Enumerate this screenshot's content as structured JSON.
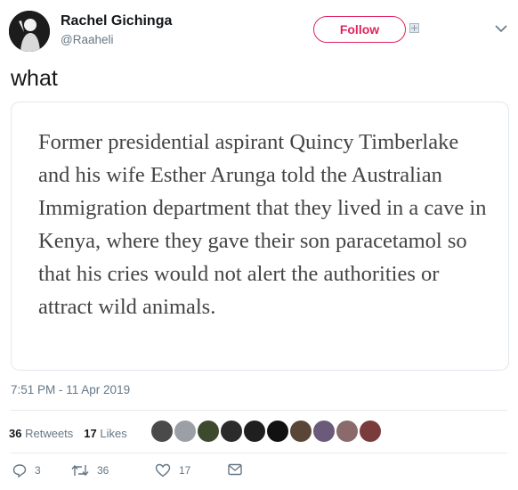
{
  "header": {
    "name": "Rachel Gichinga",
    "handle": "@Raaheli",
    "follow_label": "Follow"
  },
  "tweet": {
    "text": "what",
    "card_text": "Former presidential aspirant Quincy Timberlake and his wife Esther Arunga told the Australian Immigration department that they lived in a cave in Kenya, where they gave their son paracetamol so that his cries would not alert the authorities or attract wild animals.",
    "timestamp": "7:51 PM - 11 Apr 2019"
  },
  "stats": {
    "retweets_count": "36",
    "retweets_label": "Retweets",
    "likes_count": "17",
    "likes_label": "Likes",
    "liker_avatars": [
      "#4a4a4a",
      "#9aa0a6",
      "#3d4a2e",
      "#2b2b2b",
      "#1f1f1f",
      "#111111",
      "#5a4636",
      "#6b5a7a",
      "#8a6a6a",
      "#7a3b3b"
    ]
  },
  "actions": {
    "reply_count": "3",
    "retweet_count": "36",
    "like_count": "17"
  },
  "colors": {
    "accent": "#e0245e",
    "secondary_text": "#657786",
    "border": "#e1e8ed"
  }
}
